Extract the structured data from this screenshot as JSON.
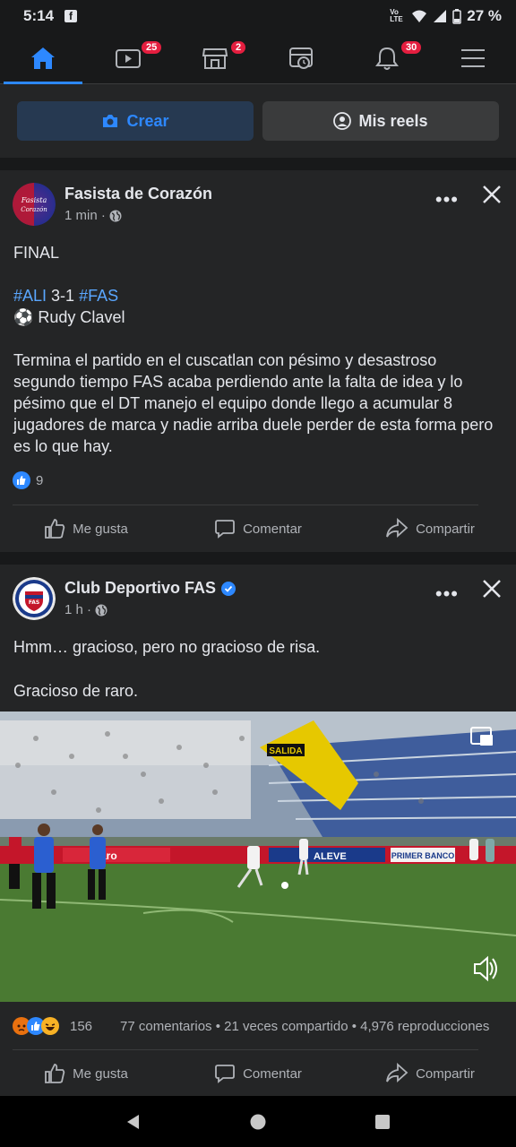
{
  "status_bar": {
    "time": "5:14",
    "network": "Vo LTE",
    "battery": "27 %"
  },
  "nav": {
    "items": [
      {
        "name": "home",
        "badge": ""
      },
      {
        "name": "watch",
        "badge": "25"
      },
      {
        "name": "marketplace",
        "badge": "2"
      },
      {
        "name": "feeds",
        "badge": ""
      },
      {
        "name": "notifications",
        "badge": "30"
      },
      {
        "name": "menu",
        "badge": ""
      }
    ]
  },
  "create": {
    "crear_label": "Crear",
    "reels_label": "Mis reels"
  },
  "posts": [
    {
      "author": "Fasista de Corazón",
      "time": "1 min ·",
      "line1": "FINAL",
      "tag1": "#ALI",
      "score": " 3-1 ",
      "tag2": "#FAS",
      "scorer": "⚽ Rudy Clavel",
      "body": "Termina el partido en el cuscatlan con pésimo y desastroso segundo tiempo FAS acaba perdiendo ante la falta de idea y lo pésimo que el DT manejo el equipo donde llego a acumular 8 jugadores de marca y nadie arriba duele perder de esta forma pero es lo que hay.",
      "reaction_count": "9",
      "like_label": "Me gusta",
      "comment_label": "Comentar",
      "share_label": "Compartir"
    },
    {
      "author": "Club Deportivo FAS",
      "time": "1 h ·",
      "line1": "Hmm… gracioso, pero no gracioso de risa.",
      "line2": "Gracioso de raro.",
      "reaction_count": "156",
      "stats": "77 comentarios • 21 veces compartido • 4,976 reproducciones",
      "like_label": "Me gusta",
      "comment_label": "Comentar",
      "share_label": "Compartir",
      "video_signage": {
        "salida": "SALIDA",
        "claro": "Claro",
        "aleve": "ALEVE",
        "primer_banco": "PRIMER BANCO"
      }
    }
  ],
  "colors": {
    "accent": "#2d88ff",
    "bg": "#18191a",
    "card": "#242526",
    "badge": "#e41e3f"
  }
}
